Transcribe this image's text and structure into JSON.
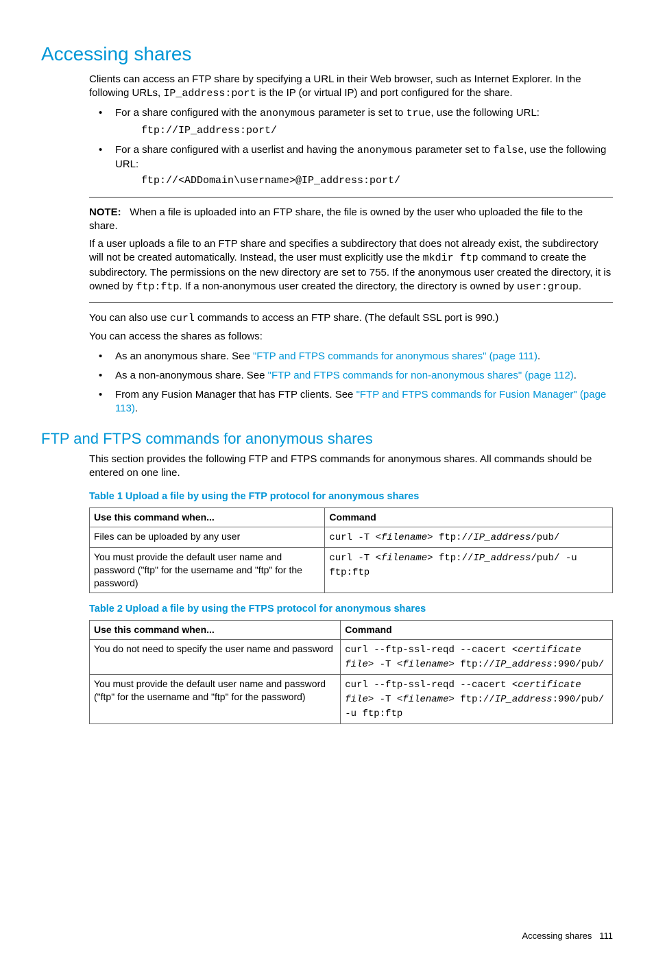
{
  "h1": "Accessing shares",
  "intro": {
    "p1_a": "Clients can access an FTP share by specifying a URL in their Web browser, such as Internet Explorer. In the following URLs, ",
    "p1_code": "IP_address:port",
    "p1_b": " is the IP (or virtual IP) and port configured for the share."
  },
  "list1": {
    "i1_a": "For a share configured with the ",
    "i1_code1": "anonymous",
    "i1_b": " parameter is set to ",
    "i1_code2": "true",
    "i1_c": ", use the following URL:",
    "i1_url": "ftp://IP_address:port/",
    "i2_a": "For a share configured with a userlist and having the ",
    "i2_code1": "anonymous",
    "i2_b": " parameter set to ",
    "i2_code2": "false",
    "i2_c": ", use the following URL:",
    "i2_url": "ftp://<ADDomain\\username>@IP_address:port/"
  },
  "note": {
    "label": "NOTE:",
    "p1": "When a file is uploaded into an FTP share, the file is owned by the user who uploaded the file to the share.",
    "p2_a": "If a user uploads a file to an FTP share and specifies a subdirectory that does not already exist, the subdirectory will not be created automatically. Instead, the user must explicitly use the ",
    "p2_code1": "mkdir ftp",
    "p2_b": " command to create the subdirectory. The permissions on the new directory are set to 755. If the anonymous user created the directory, it is owned by ",
    "p2_code2": "ftp:ftp",
    "p2_c": ". If a non-anonymous user created the directory, the directory is owned by ",
    "p2_code3": "user:group",
    "p2_d": "."
  },
  "after_note": {
    "p1_a": "You can also use ",
    "p1_code": "curl",
    "p1_b": " commands to access an FTP share. (The default SSL port is 990.)",
    "p2": "You can access the shares as follows:"
  },
  "list2": {
    "i1_a": "As an anonymous share. See ",
    "i1_link": "\"FTP and FTPS commands for anonymous shares\" (page 111)",
    "i2_a": "As a non-anonymous share. See ",
    "i2_link": "\"FTP and FTPS commands for non-anonymous shares\" (page 112)",
    "i3_a": "From any Fusion Manager that has FTP clients. See ",
    "i3_link": "\"FTP and FTPS commands for Fusion Manager\" (page 113)"
  },
  "h2": "FTP and FTPS commands for anonymous shares",
  "sec2_p": "This section provides the following FTP and FTPS commands for anonymous shares. All commands should be entered on one line.",
  "table1": {
    "caption": "Table 1 Upload a file by using the FTP protocol for anonymous shares",
    "h1": "Use this command when...",
    "h2": "Command",
    "r1c1": "Files can be uploaded by any user",
    "r1c2_a": "curl -T ",
    "r1c2_i": "<filename>",
    "r1c2_b": " ftp://",
    "r1c2_i2": "IP_address",
    "r1c2_c": "/pub/",
    "r2c1": "You must provide the default user name and password (\"ftp\" for the username and \"ftp\" for the password)",
    "r2c2_a": "curl -T ",
    "r2c2_i": "<filename>",
    "r2c2_b": " ftp://",
    "r2c2_i2": "IP_address",
    "r2c2_c": "/pub/ -u ftp:ftp"
  },
  "table2": {
    "caption": "Table 2 Upload a file by using the FTPS protocol for anonymous shares",
    "h1": "Use this command when...",
    "h2": "Command",
    "r1c1": "You do not need to specify the user name and password",
    "r1c2_a": "curl --ftp-ssl-reqd --cacert ",
    "r1c2_i1": "<certificate file>",
    "r1c2_b": " -T ",
    "r1c2_i2": "<filename>",
    "r1c2_c": " ftp://",
    "r1c2_i3": "IP_address",
    "r1c2_d": ":990/pub/",
    "r2c1": "You must provide the default user name and password (\"ftp\" for the username and \"ftp\" for the password)",
    "r2c2_a": "curl --ftp-ssl-reqd --cacert ",
    "r2c2_i1": "<certificate file>",
    "r2c2_b": " -T ",
    "r2c2_i2": "<filename>",
    "r2c2_c": " ftp://",
    "r2c2_i3": "IP_address",
    "r2c2_d": ":990/pub/ -u ftp:ftp"
  },
  "footer": {
    "text": "Accessing shares",
    "page": "111"
  }
}
